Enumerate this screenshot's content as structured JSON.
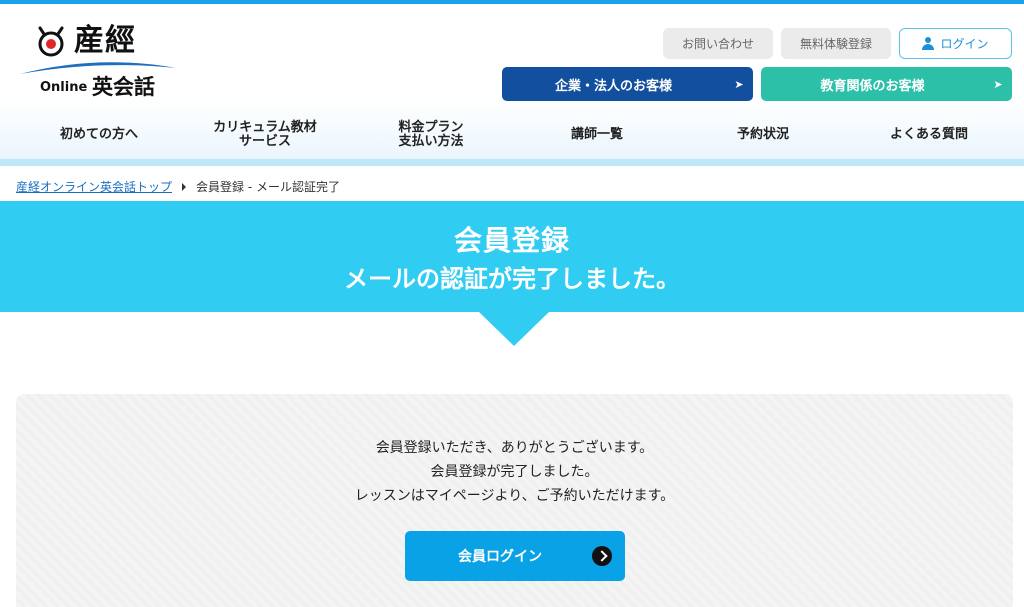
{
  "logo": {
    "kanji": "産經",
    "online": "Online",
    "eikaiwa": "英会話"
  },
  "utility": {
    "contact": "お問い合わせ",
    "trial": "無料体験登録",
    "login": "ログイン"
  },
  "business": {
    "corporate": "企業・法人のお客様",
    "education": "教育関係のお客様",
    "arrow": "➤"
  },
  "nav": [
    "初めての方へ",
    "カリキュラム教材\nサービス",
    "料金プラン\n支払い方法",
    "講師一覧",
    "予約状況",
    "よくある質問"
  ],
  "breadcrumb": {
    "home": "産経オンライン英会話トップ",
    "current": "会員登録 - メール認証完了"
  },
  "hero": {
    "title": "会員登録",
    "subtitle": "メールの認証が完了しました。"
  },
  "panel": {
    "lines": [
      "会員登録いただき、ありがとうございます。",
      "会員登録が完了しました。",
      "レッスンはマイページより、ご予約いただけます。"
    ],
    "button": "会員ログイン"
  },
  "colors": {
    "hero": "#30ccf2",
    "corporate": "#124f9e",
    "education": "#2cc0a9",
    "cta": "#0aa2e6"
  }
}
